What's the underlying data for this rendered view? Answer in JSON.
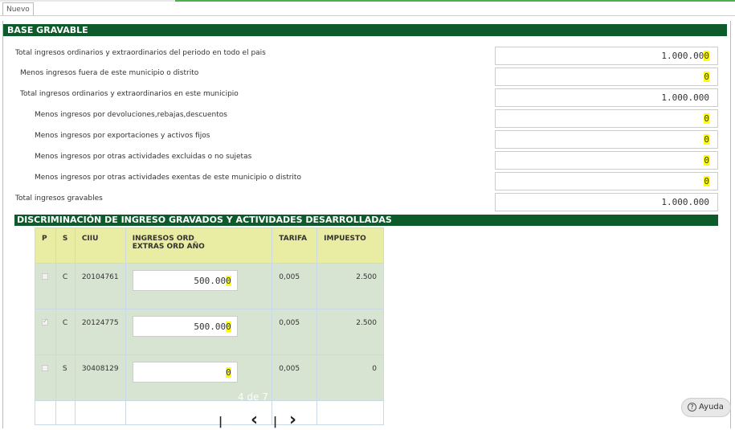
{
  "tab": {
    "label": "Nuevo"
  },
  "base_gravable": {
    "title": "BASE GRAVABLE",
    "rows": [
      {
        "label": "Total ingresos ordinarios y extraordinarios del periodo en todo el pais",
        "value_main": "1.000.00",
        "value_hl": "0"
      },
      {
        "label": "Menos ingresos fuera de este municipio o distrito",
        "value_main": "",
        "value_hl": "0"
      },
      {
        "label": "Total ingresos ordinarios y extraordinarios en este municipio",
        "value_main": "1.000.000",
        "value_hl": ""
      },
      {
        "label": "Menos ingresos por devoluciones,rebajas,descuentos",
        "value_main": "",
        "value_hl": "0"
      },
      {
        "label": "Menos ingresos por exportaciones y activos fijos",
        "value_main": "",
        "value_hl": "0"
      },
      {
        "label": "Menos ingresos por otras actividades excluidas o no sujetas",
        "value_main": "",
        "value_hl": "0"
      },
      {
        "label": "Menos ingresos por otras actividades exentas de este municipio o distrito",
        "value_main": "",
        "value_hl": "0"
      },
      {
        "label": "Total ingresos gravables",
        "value_main": "1.000.000",
        "value_hl": ""
      }
    ]
  },
  "discriminacion": {
    "title": "DISCRIMINACIÓN DE INGRESO GRAVADOS Y ACTIVIDADES DESARROLLADAS",
    "columns": {
      "p": "P",
      "s": "S",
      "ciiu": "CIIU",
      "ingresos_1": "INGRESOS ORD",
      "ingresos_2": "EXTRAS ORD AÑO",
      "tarifa": "TARIFA",
      "impuesto": "IMPUESTO"
    },
    "rows": [
      {
        "checked": false,
        "s": "C",
        "ciiu": "20104761",
        "ingresos_main": "500.00",
        "ingresos_hl": "0",
        "tarifa": "0,005",
        "impuesto": "2.500"
      },
      {
        "checked": true,
        "s": "C",
        "ciiu": "20124775",
        "ingresos_main": "500.00",
        "ingresos_hl": "0",
        "tarifa": "0,005",
        "impuesto": "2.500"
      },
      {
        "checked": false,
        "s": "S",
        "ciiu": "30408129",
        "ingresos_main": "",
        "ingresos_hl": "0",
        "tarifa": "0,005",
        "impuesto": "0"
      }
    ]
  },
  "pager": {
    "text": "4 de 7"
  },
  "help": {
    "label": "Ayuda",
    "icon": "question-circle-icon"
  }
}
